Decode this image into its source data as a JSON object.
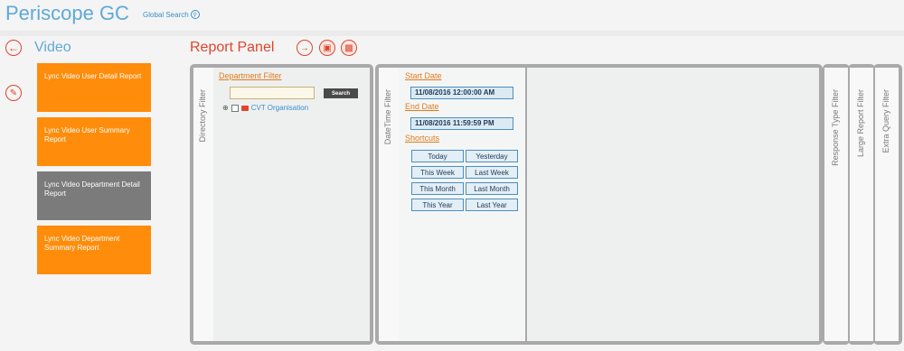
{
  "header": {
    "logo": "Periscope GC",
    "global_search": "Global Search"
  },
  "left": {
    "section_title": "Video",
    "tiles": [
      "Lync Video User Detail Report",
      "Lync Video User Summary Report",
      "Lync Video Department Detail Report",
      "Lync Video Department Summary Report"
    ]
  },
  "panel": {
    "title": "Report Panel",
    "directory_filter": {
      "tab_label": "Directory Filter",
      "heading": "Department Filter",
      "search_button": "Search",
      "tree_node": "CVT Organisation"
    },
    "datetime_filter": {
      "tab_label": "DateTime Filter",
      "start_label": "Start Date",
      "start_value": "11/08/2016 12:00:00 AM",
      "end_label": "End Date",
      "end_value": "11/08/2016 11:59:59 PM",
      "shortcuts_label": "Shortcuts",
      "shortcuts": [
        "Today",
        "Yesterday",
        "This Week",
        "Last Week",
        "This Month",
        "Last Month",
        "This Year",
        "Last Year"
      ]
    },
    "side_tabs": [
      "Response Type Filter",
      "Large Report Filter",
      "Extra Query Filter"
    ]
  },
  "colors": {
    "accent": "#e0442a",
    "brand_blue": "#5ea9d6",
    "tile_orange": "#ff8c0a",
    "tile_active": "#7b7b7b"
  }
}
